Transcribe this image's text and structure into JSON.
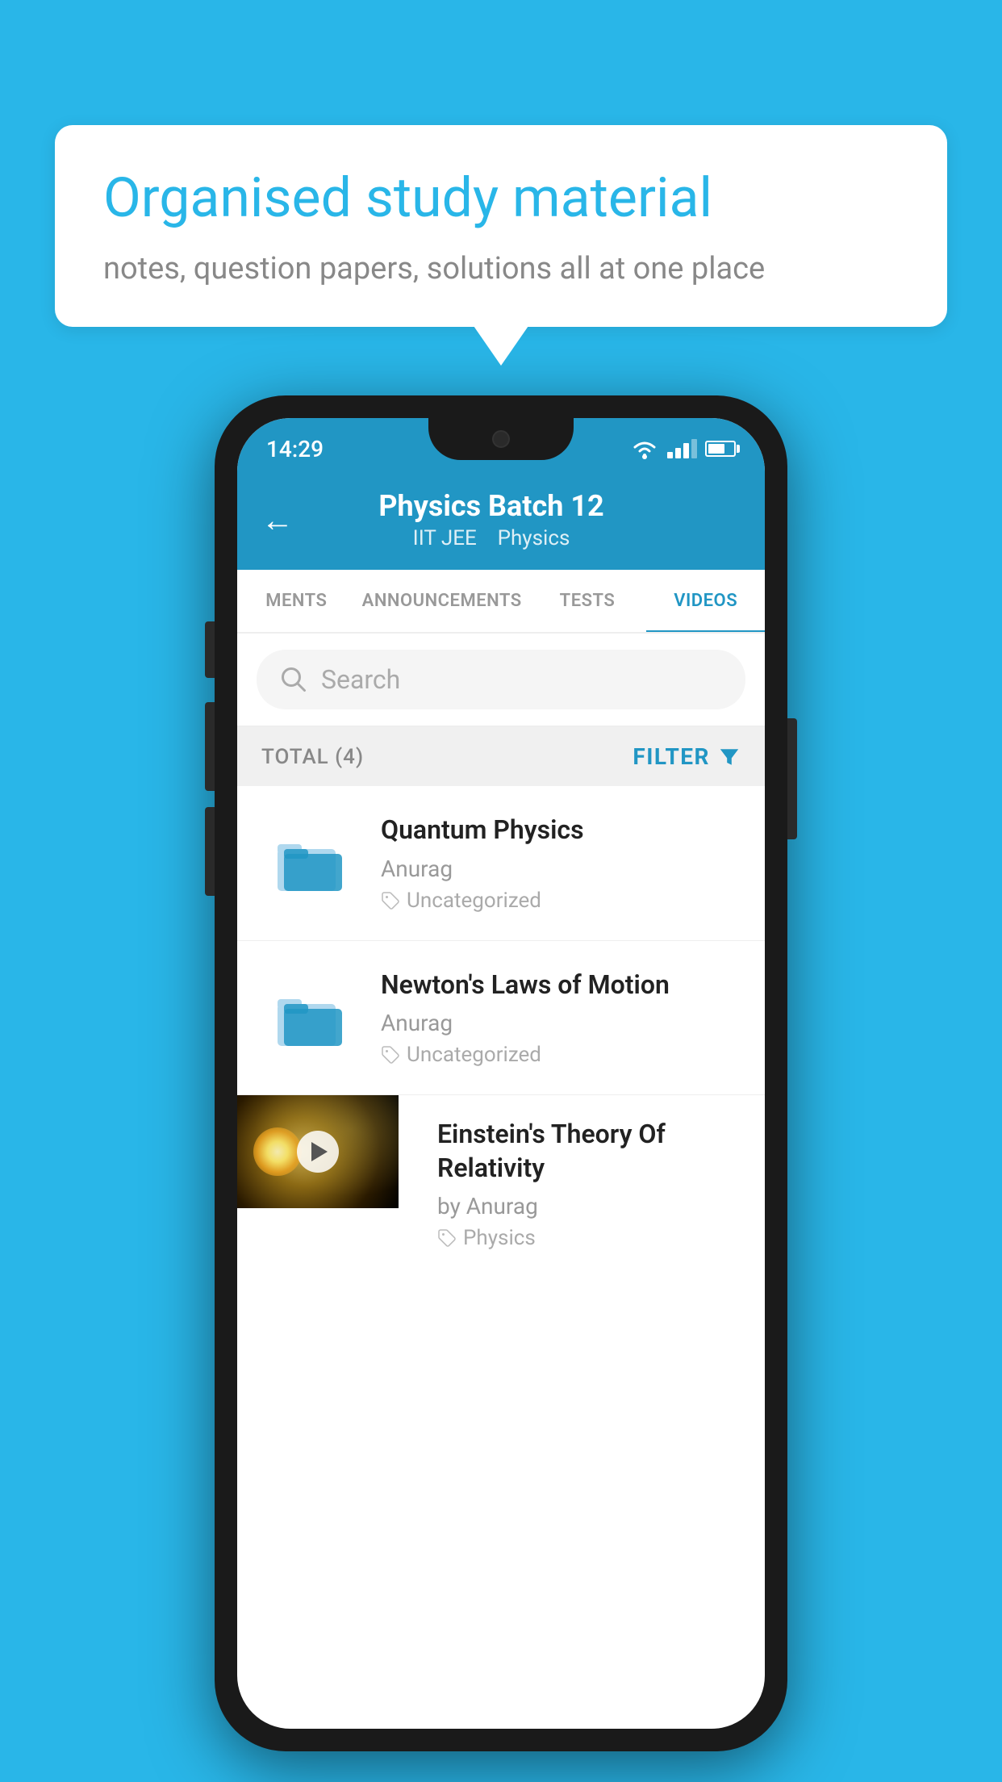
{
  "background_color": "#29b6e8",
  "speech_bubble": {
    "title": "Organised study material",
    "subtitle": "notes, question papers, solutions all at one place"
  },
  "status_bar": {
    "time": "14:29"
  },
  "app_header": {
    "title": "Physics Batch 12",
    "subtitle_part1": "IIT JEE",
    "subtitle_part2": "Physics"
  },
  "tabs": [
    {
      "label": "MENTS",
      "active": false
    },
    {
      "label": "ANNOUNCEMENTS",
      "active": false
    },
    {
      "label": "TESTS",
      "active": false
    },
    {
      "label": "VIDEOS",
      "active": true
    }
  ],
  "search": {
    "placeholder": "Search"
  },
  "filter_bar": {
    "total_label": "TOTAL (4)",
    "filter_label": "FILTER"
  },
  "videos": [
    {
      "title": "Quantum Physics",
      "author": "Anurag",
      "tag": "Uncategorized",
      "has_thumbnail": false
    },
    {
      "title": "Newton's Laws of Motion",
      "author": "Anurag",
      "tag": "Uncategorized",
      "has_thumbnail": false
    },
    {
      "title": "Einstein's Theory Of Relativity",
      "author": "by Anurag",
      "tag": "Physics",
      "has_thumbnail": true
    }
  ]
}
